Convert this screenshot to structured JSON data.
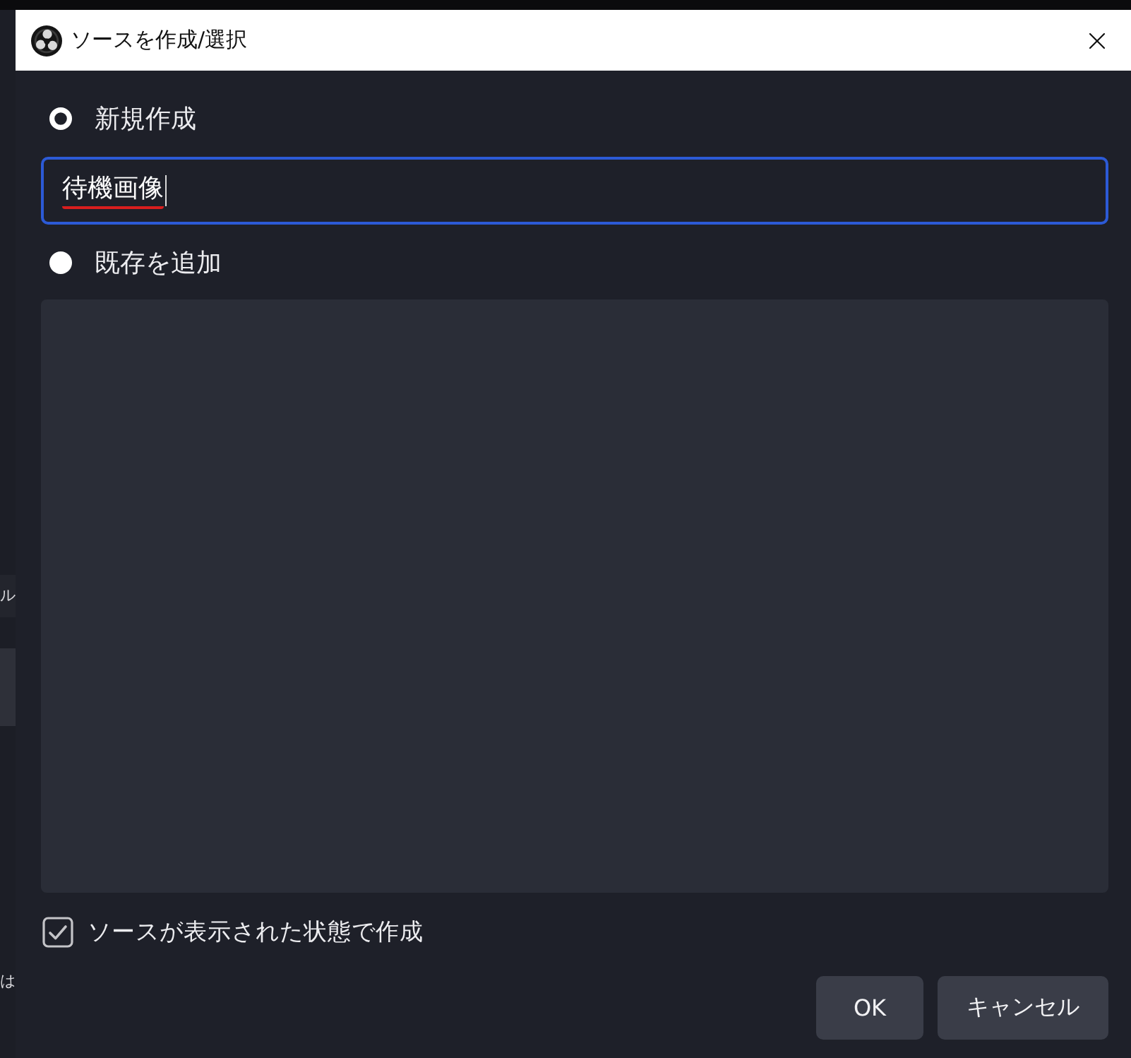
{
  "window": {
    "title": "ソースを作成/選択"
  },
  "background_window": {
    "texts": [
      "ル",
      "は"
    ]
  },
  "modes": [
    {
      "label": "新規作成",
      "selected": true
    },
    {
      "label": "既存を追加",
      "selected": false
    }
  ],
  "name_field": {
    "value": "待機画像",
    "focused": true,
    "ime_composing": true
  },
  "visible_checkbox": {
    "label": "ソースが表示された状態で作成",
    "checked": true
  },
  "buttons": [
    {
      "label": "OK"
    },
    {
      "label": "キャンセル"
    }
  ]
}
